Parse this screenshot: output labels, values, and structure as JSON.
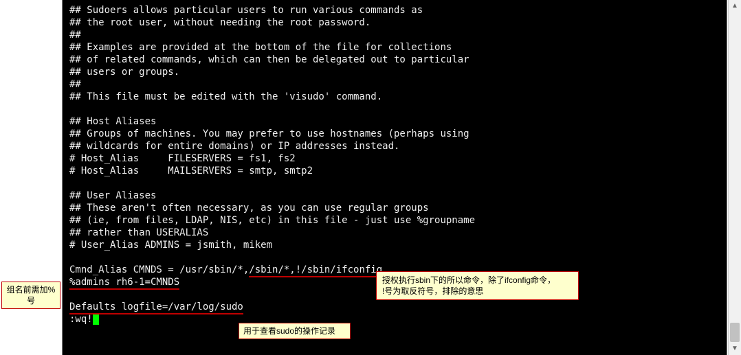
{
  "terminal": {
    "l1": "## Sudoers allows particular users to run various commands as",
    "l2": "## the root user, without needing the root password.",
    "l3": "##",
    "l4": "## Examples are provided at the bottom of the file for collections",
    "l5": "## of related commands, which can then be delegated out to particular",
    "l6": "## users or groups.",
    "l7": "##",
    "l8": "## This file must be edited with the 'visudo' command.",
    "l9": "",
    "l10": "## Host Aliases",
    "l11": "## Groups of machines. You may prefer to use hostnames (perhaps using",
    "l12": "## wildcards for entire domains) or IP addresses instead.",
    "l13": "# Host_Alias     FILESERVERS = fs1, fs2",
    "l14": "# Host_Alias     MAILSERVERS = smtp, smtp2",
    "l15": "",
    "l16": "## User Aliases",
    "l17": "## These aren't often necessary, as you can use regular groups",
    "l18": "## (ie, from files, LDAP, NIS, etc) in this file - just use %groupname",
    "l19": "## rather than USERALIAS",
    "l20": "# User_Alias ADMINS = jsmith, mikem",
    "l21": "",
    "l22a": "Cmnd_Alias CMNDS = /usr/sbin/*,",
    "l22b": "/sbin/*,!/sbin/ifconfig",
    "l23": "%admins rh6-1=CMNDS",
    "l24": "",
    "l25": "Defaults logfile=/var/log/sudo",
    "l26": ":wq!"
  },
  "callouts": {
    "left": "组名前需加%号",
    "right_line1": "授权执行sbin下的所以命令，除了ifconfig命令，",
    "right_line2": "!号为取反符号，排除的意思",
    "bottom": "用于查看sudo的操作记录"
  }
}
